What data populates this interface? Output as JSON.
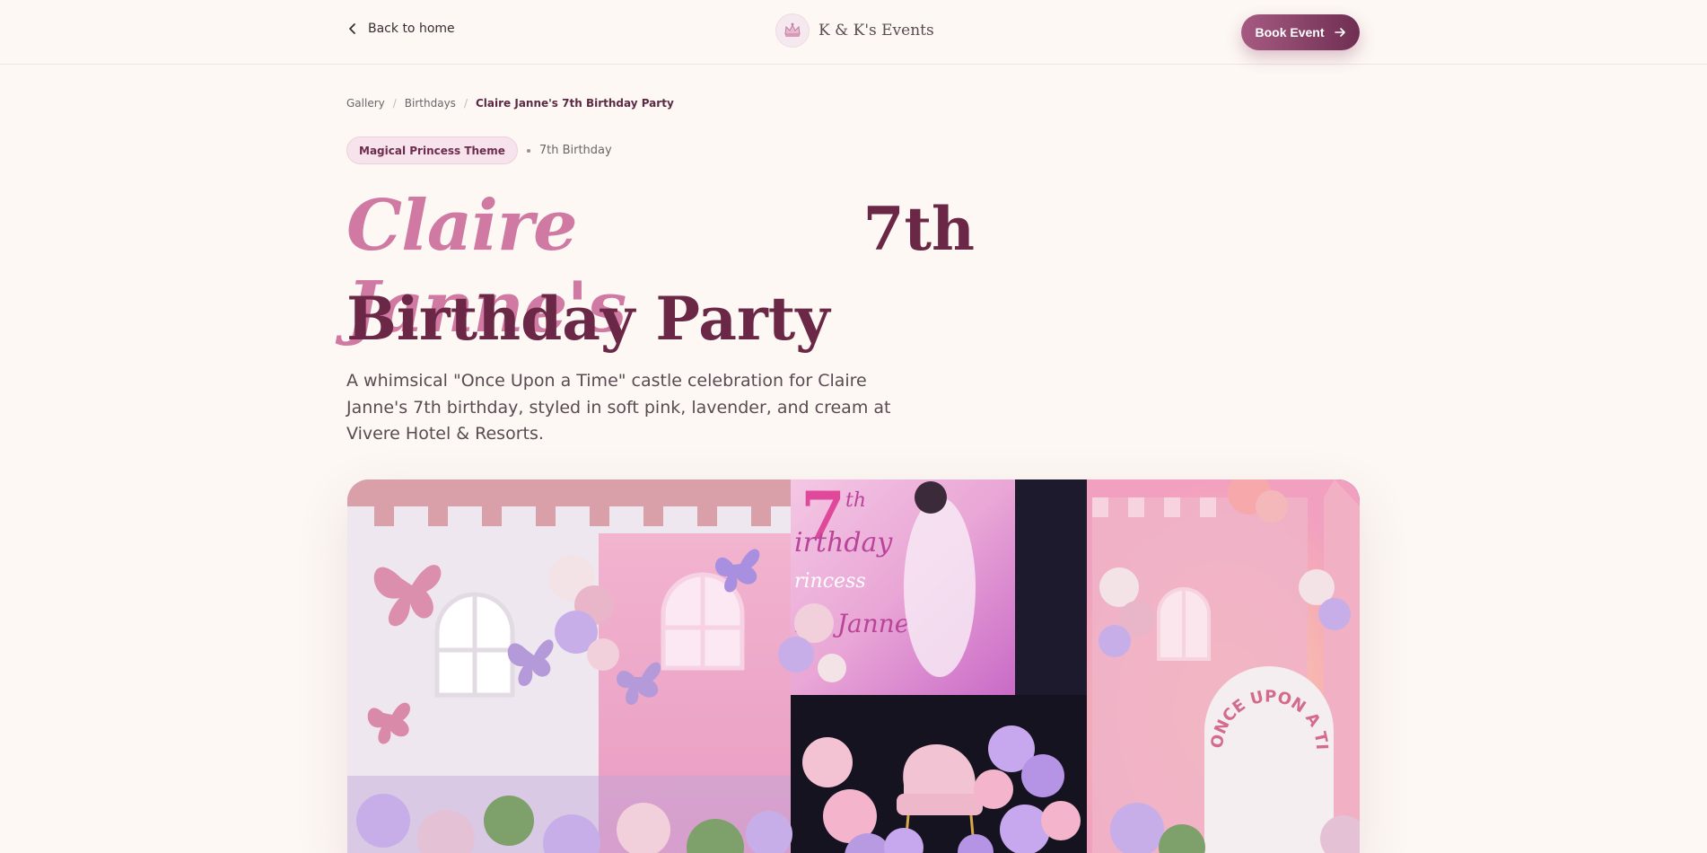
{
  "header": {
    "back_label": "Back to home",
    "brand_name": "K & K's Events",
    "book_label": "Book Event"
  },
  "breadcrumb": {
    "items": [
      "Gallery",
      "Birthdays",
      "Claire Janne's 7th Birthday Party"
    ],
    "separator": "/"
  },
  "tags": {
    "theme": "Magical Princess Theme",
    "occasion": "7th Birthday"
  },
  "title": {
    "script": "Claire Janne's",
    "line1_rest": "7th",
    "line2": "Birthday Party"
  },
  "description": "A whimsical \"Once Upon a Time\" castle celebration for Claire Janne's 7th birthday, styled in soft pink, lavender, and cream at Vivere Hotel & Resorts.",
  "hero": {
    "screen_number": "7",
    "screen_th": "th",
    "screen_line1": "irthday",
    "screen_line2": "rincess",
    "screen_line3": "ire Janne",
    "arch_text": "ONCE UPON A TIME"
  },
  "colors": {
    "background": "#fdf8f4",
    "accent": "#6b2846",
    "script_pink": "#d07aa3",
    "pill_bg": "#f7e3ec",
    "button_start": "#a65a82",
    "button_end": "#6f2f52"
  },
  "icons": {
    "back": "chevron-left-icon",
    "book": "arrow-right-icon",
    "logo": "crown-logo-icon"
  }
}
